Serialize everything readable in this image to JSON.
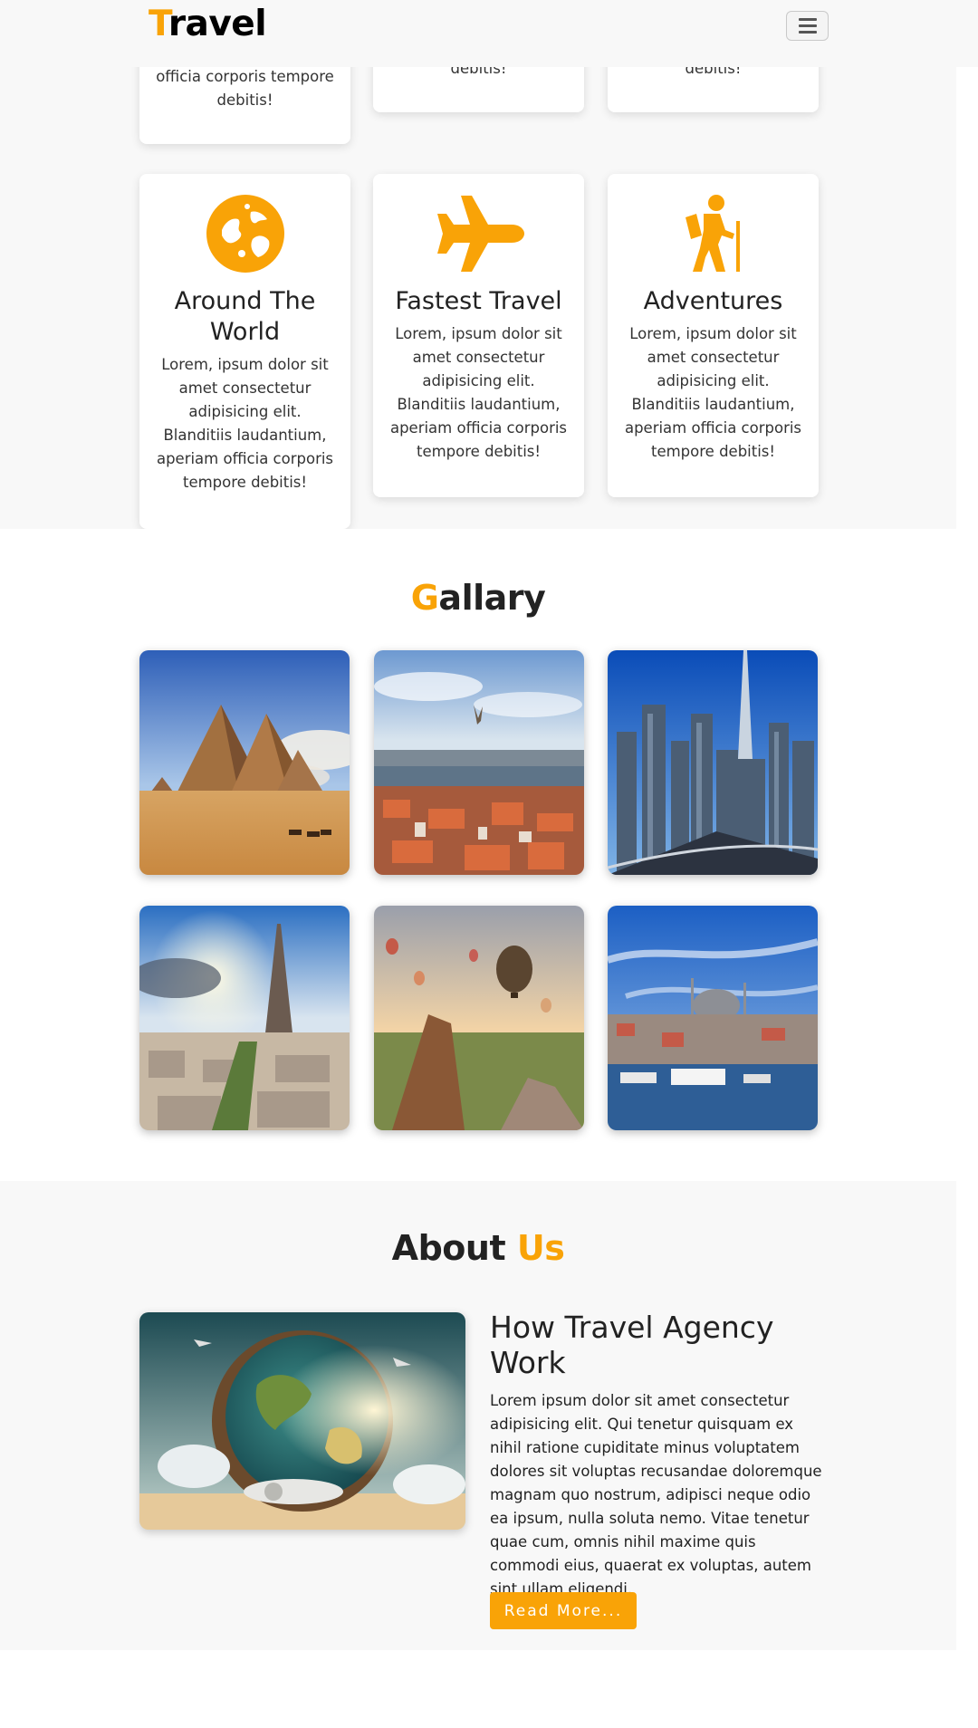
{
  "navbar": {
    "brand_accent": "T",
    "brand_rest": "ravel",
    "menu_icon": "hamburger-icon"
  },
  "services": {
    "partial_cards": [
      {
        "text": "officia corporis tempore debitis!"
      },
      {
        "text": "debitis!"
      },
      {
        "text": "debitis!"
      }
    ],
    "cards": [
      {
        "icon": "globe-icon",
        "title": "Around The World",
        "text": "Lorem, ipsum dolor sit amet consectetur adipisicing elit. Blanditiis laudantium, aperiam officia corporis tempore debitis!"
      },
      {
        "icon": "airplane-icon",
        "title": "Fastest Travel",
        "text": "Lorem, ipsum dolor sit amet consectetur adipisicing elit. Blanditiis laudantium, aperiam officia corporis tempore debitis!"
      },
      {
        "icon": "hiker-icon",
        "title": "Adventures",
        "text": "Lorem, ipsum dolor sit amet consectetur adipisicing elit. Blanditiis laudantium, aperiam officia corporis tempore debitis!"
      }
    ]
  },
  "gallery": {
    "heading_accent": "G",
    "heading_rest": "allary",
    "images": [
      "pyramids-photo",
      "city-bird-photo",
      "skyline-photo",
      "eiffel-tower-photo",
      "hot-air-balloons-photo",
      "harbor-mosque-photo"
    ]
  },
  "about": {
    "heading_main": "About ",
    "heading_accent": "Us",
    "image": "globe-travel-illustration",
    "title": "How Travel Agency Work",
    "text": "Lorem ipsum dolor sit amet consectetur adipisicing elit. Qui tenetur quisquam ex nihil ratione cupiditate minus voluptatem dolores sit voluptas recusandae doloremque magnam quo nostrum, adipisci neque odio ea ipsum, nulla soluta nemo. Vitae tenetur quae cum, omnis nihil maxime quis commodi eius, quaerat ex voluptas, autem sint ullam eligendi.",
    "button_label": "Read More..."
  },
  "colors": {
    "accent": "#f9a307",
    "section_bg": "#f8f8f8"
  }
}
